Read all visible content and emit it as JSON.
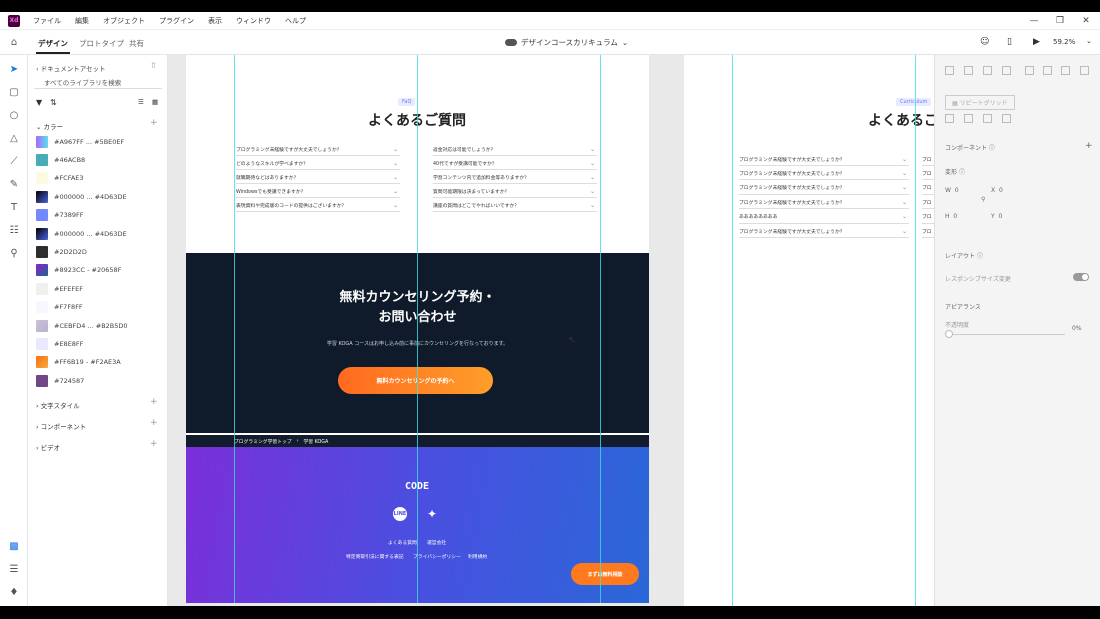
{
  "menubar": {
    "logo": "Xd",
    "items": [
      "ファイル",
      "編集",
      "オブジェクト",
      "プラグイン",
      "表示",
      "ウィンドウ",
      "ヘルプ"
    ]
  },
  "tabs": [
    "デザイン",
    "プロトタイプ",
    "共有"
  ],
  "document_title": "デザインコースカリキュラム",
  "zoom": "59.2%",
  "assets": {
    "header": "ドキュメントアセット",
    "search_placeholder": "すべてのライブラリを検索",
    "colors_label": "カラー",
    "colors": [
      {
        "label": "#A967FF ... #5BE0EF",
        "swatch": "linear-gradient(90deg,#A967FF,#5BE0EF)"
      },
      {
        "label": "#46ACB8",
        "swatch": "#46ACB8"
      },
      {
        "label": "#FCFAE3",
        "swatch": "#FCFAE3"
      },
      {
        "label": "#000000 ... #4D63DE",
        "swatch": "linear-gradient(135deg,#000000,#4D63DE)"
      },
      {
        "label": "#7389FF",
        "swatch": "#7389FF"
      },
      {
        "label": "#000000 ... #4D63DE",
        "swatch": "linear-gradient(135deg,#000000,#4D63DE)"
      },
      {
        "label": "#2D2D2D",
        "swatch": "#2D2D2D"
      },
      {
        "label": "#8923CC - #20658F",
        "swatch": "linear-gradient(135deg,#8923CC,#20658F)"
      },
      {
        "label": "#EFEFEF",
        "swatch": "#EFEFEF"
      },
      {
        "label": "#F7F8FF",
        "swatch": "#F7F8FF"
      },
      {
        "label": "#CEBFD4 ... #B2B5D0",
        "swatch": "linear-gradient(135deg,#CEBFD4,#B2B5D0)"
      },
      {
        "label": "#E8E8FF",
        "swatch": "#E8E8FF"
      },
      {
        "label": "#FF6B19 - #F2AE3A",
        "swatch": "linear-gradient(135deg,#FF6B19,#F2AE3A)"
      },
      {
        "label": "#724587",
        "swatch": "#724587"
      }
    ],
    "sections": [
      "文字スタイル",
      "コンポーネント",
      "ビデオ"
    ]
  },
  "artboard1": {
    "faq_label": "FaQ",
    "faq_title": "よくあるご質問",
    "faq_left": [
      "プログラミング未経験ですが大丈夫でしょうか？",
      "どのようなスキルが学べますか？",
      "就職期待などはありますか？",
      "Windowsでも受講できますか？",
      "表現資料や完成版のコードの提供はございますか？"
    ],
    "faq_right": [
      "返金対応は可能でしょうか？",
      "40代ですが受講可能ですか？",
      "学習コンテンツ内で追加料金等ありますか？",
      "質問可能期限は決まっていますか？",
      "講座の質問はどこでやればいいですか？"
    ],
    "cta_title_line1": "無料カウンセリング予約・",
    "cta_title_line2": "お問い合わせ",
    "cta_sub": "学習 KOGA コースはお申し込み前に事前にカウンセリングを行なっております。",
    "cta_button": "無料カウンセリングの予約へ",
    "breadcrumb_home": "プログラミング学習トップ",
    "breadcrumb_current": "学習 KOGA",
    "logo": "CODE",
    "social_line": "LINE",
    "social_twitter": "Twitter",
    "footer_links_row1": [
      "よくある質問",
      "運営会社"
    ],
    "footer_links_row2": [
      "特定商取引法に関する表記",
      "プライバシーポリシー",
      "利用規約"
    ],
    "footer_button": "まずは無料相談"
  },
  "artboard2": {
    "label": "Curriculum",
    "title": "よくあるご",
    "faq_rows": [
      "プログラミング未経験ですが大丈夫でしょうか？",
      "プログラミング未経験ですが大丈夫でしょうか？",
      "プログラミング未経験ですが大丈夫でしょうか？",
      "プログラミング未経験ですが大丈夫でしょうか？",
      "ああああああああ",
      "プログラミング未経験ですが大丈夫でしょうか？"
    ],
    "right_col_stub": [
      "プロ",
      "プロ",
      "プロ",
      "プロ",
      "プロ",
      "プロ"
    ]
  },
  "props": {
    "repeat_grid": "リピートグリッド",
    "component_label": "コンポーネント",
    "transform_label": "変形",
    "w_label": "W",
    "w_value": "0",
    "x_label": "X",
    "x_value": "0",
    "h_label": "H",
    "h_value": "0",
    "y_label": "Y",
    "y_value": "0",
    "layout_label": "レイアウト",
    "responsive_label": "レスポンシブサイズ変更",
    "appearance_label": "アピアランス",
    "opacity_label": "不透明度",
    "opacity_value": "0%"
  }
}
